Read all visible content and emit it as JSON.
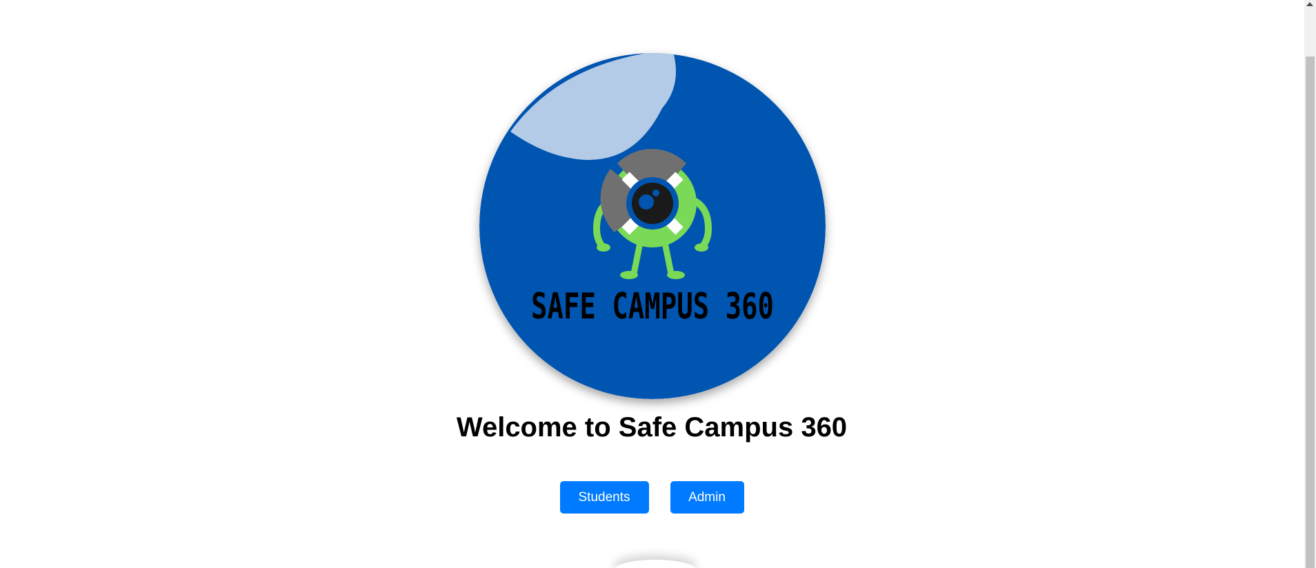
{
  "logo": {
    "brand_text": "SAFE CAMPUS 360",
    "colors": {
      "circle_blue": "#0055b0",
      "highlight": "#b3cbe6",
      "mascot_green": "#7ad957",
      "mascot_gray": "#707070",
      "eye_dark": "#1a1a1a",
      "text_black": "#000000"
    },
    "icon": "life-ring-camera-mascot"
  },
  "welcome_title": "Welcome to Safe Campus 360",
  "buttons": {
    "students_label": "Students",
    "admin_label": "Admin",
    "color": "#007bff"
  }
}
